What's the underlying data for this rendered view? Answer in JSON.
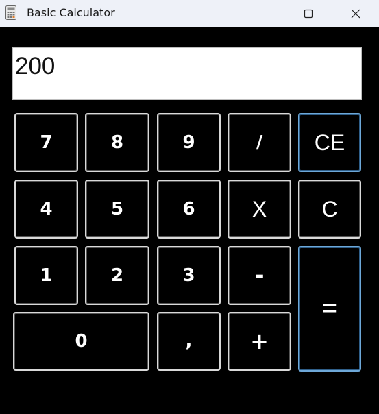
{
  "window": {
    "title": "Basic Calculator",
    "controls": {
      "minimize": "minimize",
      "maximize": "maximize",
      "close": "close"
    }
  },
  "display": {
    "value": "200"
  },
  "keys": {
    "k7": "7",
    "k8": "8",
    "k9": "9",
    "div": "/",
    "ce": "CE",
    "k4": "4",
    "k5": "5",
    "k6": "6",
    "mul": "X",
    "c": "C",
    "k1": "1",
    "k2": "2",
    "k3": "3",
    "sub": "-",
    "eq": "=",
    "k0": "0",
    "comma": ",",
    "add": "+"
  },
  "colors": {
    "background": "#000000",
    "titlebar": "#eef1f8",
    "key_border": "#d9d9d9",
    "accent_border": "#6ea8d8",
    "display_bg": "#ffffff"
  }
}
